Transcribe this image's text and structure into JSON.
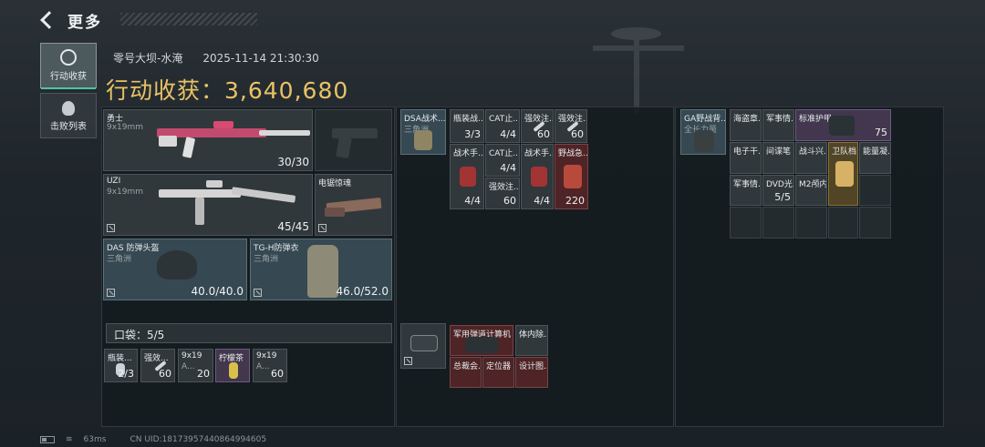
{
  "header": {
    "title": "更多"
  },
  "tabs": [
    {
      "label": "行动收获",
      "active": true,
      "icon": "target-icon"
    },
    {
      "label": "击败列表",
      "active": false,
      "icon": "skull-icon"
    }
  ],
  "meta": {
    "map": "零号大坝-水淹",
    "datetime": "2025-11-14 21:30:30"
  },
  "harvest": {
    "label": "行动收获：",
    "value": "3,640,680"
  },
  "loadout": {
    "primary": {
      "name": "勇士",
      "caliber": "9x19mm",
      "ammo": "30/30"
    },
    "sidearm_empty": true,
    "secondary": {
      "name": "UZI",
      "caliber": "9x19mm",
      "ammo": "45/45"
    },
    "melee": {
      "name": "电锯惊魂"
    },
    "helmet": {
      "name": "DAS 防弹头盔",
      "origin": "三角洲",
      "durability": "40.0/40.0"
    },
    "armor": {
      "name": "TG-H防弹衣",
      "origin": "三角洲",
      "durability": "46.0/52.0"
    }
  },
  "pocket": {
    "label": "口袋：5/5",
    "items": [
      {
        "name": "瓶装...",
        "count": "2/3"
      },
      {
        "name": "强效...",
        "count": "60"
      },
      {
        "name": "9x19",
        "sub": "A...",
        "count": "20"
      },
      {
        "name": "柠檬茶",
        "count": ""
      },
      {
        "name": "9x19",
        "sub": "A...",
        "count": "60"
      }
    ]
  },
  "chest_rig": {
    "name": "DSA战术...",
    "origin": "三角洲",
    "items": [
      {
        "name": "瓶装战...",
        "count": "3/3"
      },
      {
        "name": "CAT止...",
        "count": "4/4"
      },
      {
        "name": "强效注...",
        "count": "60"
      },
      {
        "name": "强效注...",
        "count": "60"
      },
      {
        "name": "战术手...",
        "count": "4/4"
      },
      {
        "name": "CAT止...",
        "count": "4/4"
      },
      {
        "name": "战术手...",
        "count": "4/4"
      },
      {
        "name": "野战急...",
        "count": "220"
      },
      {
        "name": "强效注...",
        "count": "60"
      }
    ]
  },
  "backpack": {
    "name": "GA野战背...",
    "origin": "全长力量",
    "items": [
      {
        "name": "海盗章..."
      },
      {
        "name": "军事情..."
      },
      {
        "name": "标准护甲...",
        "count": "75"
      },
      {
        "name": "电子干..."
      },
      {
        "name": "间谍笔"
      },
      {
        "name": "战斗兴..."
      },
      {
        "name": "卫队档..."
      },
      {
        "name": "能量凝..."
      },
      {
        "name": "军事情..."
      },
      {
        "name": "DVD光...",
        "count": "5/5"
      },
      {
        "name": "M2颅内..."
      }
    ]
  },
  "safebox": {
    "items": [
      {
        "name": "军用弹道计算机"
      },
      {
        "name": "体内除..."
      },
      {
        "name": "总裁会..."
      },
      {
        "name": "定位器"
      },
      {
        "name": "设计图..."
      }
    ]
  },
  "footer": {
    "ping": "63ms",
    "uid": "CN UID:18173957440864994605"
  }
}
